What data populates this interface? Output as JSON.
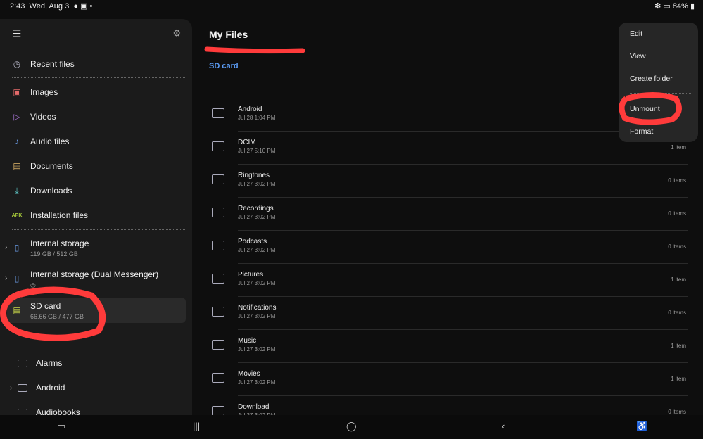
{
  "status_bar": {
    "time": "2:43",
    "date": "Wed, Aug 3",
    "battery": "84%"
  },
  "sidebar": {
    "recent": "Recent files",
    "categories": [
      {
        "label": "Images",
        "icon": "image-icon",
        "color": "#e36a6a"
      },
      {
        "label": "Videos",
        "icon": "video-icon",
        "color": "#b07ae0"
      },
      {
        "label": "Audio files",
        "icon": "music-note-icon",
        "color": "#6a9ae3"
      },
      {
        "label": "Documents",
        "icon": "document-icon",
        "color": "#e3b86a"
      },
      {
        "label": "Downloads",
        "icon": "download-icon",
        "color": "#5cc0c0"
      },
      {
        "label": "Installation files",
        "icon": "apk-icon",
        "icon_text": "APK",
        "color": "#a4c639"
      }
    ],
    "storage": [
      {
        "label": "Internal storage",
        "sub": "119 GB / 512 GB"
      },
      {
        "label": "Internal storage (Dual Messenger)",
        "sub": "◎"
      },
      {
        "label": "SD card",
        "sub": "66.66 GB / 477 GB"
      }
    ],
    "folders": [
      "Alarms",
      "Android",
      "Audiobooks"
    ]
  },
  "main": {
    "title": "My Files",
    "breadcrumb": "SD card",
    "rows": [
      {
        "name": "Android",
        "date": "Jul 28 1:04 PM",
        "count": ""
      },
      {
        "name": "DCIM",
        "date": "Jul 27 5:10 PM",
        "count": "1 item"
      },
      {
        "name": "Ringtones",
        "date": "Jul 27 3:02 PM",
        "count": "0 items"
      },
      {
        "name": "Recordings",
        "date": "Jul 27 3:02 PM",
        "count": "0 items"
      },
      {
        "name": "Podcasts",
        "date": "Jul 27 3:02 PM",
        "count": "0 items"
      },
      {
        "name": "Pictures",
        "date": "Jul 27 3:02 PM",
        "count": "1 item"
      },
      {
        "name": "Notifications",
        "date": "Jul 27 3:02 PM",
        "count": "0 items"
      },
      {
        "name": "Music",
        "date": "Jul 27 3:02 PM",
        "count": "1 item"
      },
      {
        "name": "Movies",
        "date": "Jul 27 3:02 PM",
        "count": "1 item"
      },
      {
        "name": "Download",
        "date": "Jul 27 3:02 PM",
        "count": "0 items"
      }
    ]
  },
  "menu": {
    "items": [
      "Edit",
      "View",
      "Create folder",
      "Unmount",
      "Format"
    ]
  },
  "annotation_color": "#ff3b3b"
}
